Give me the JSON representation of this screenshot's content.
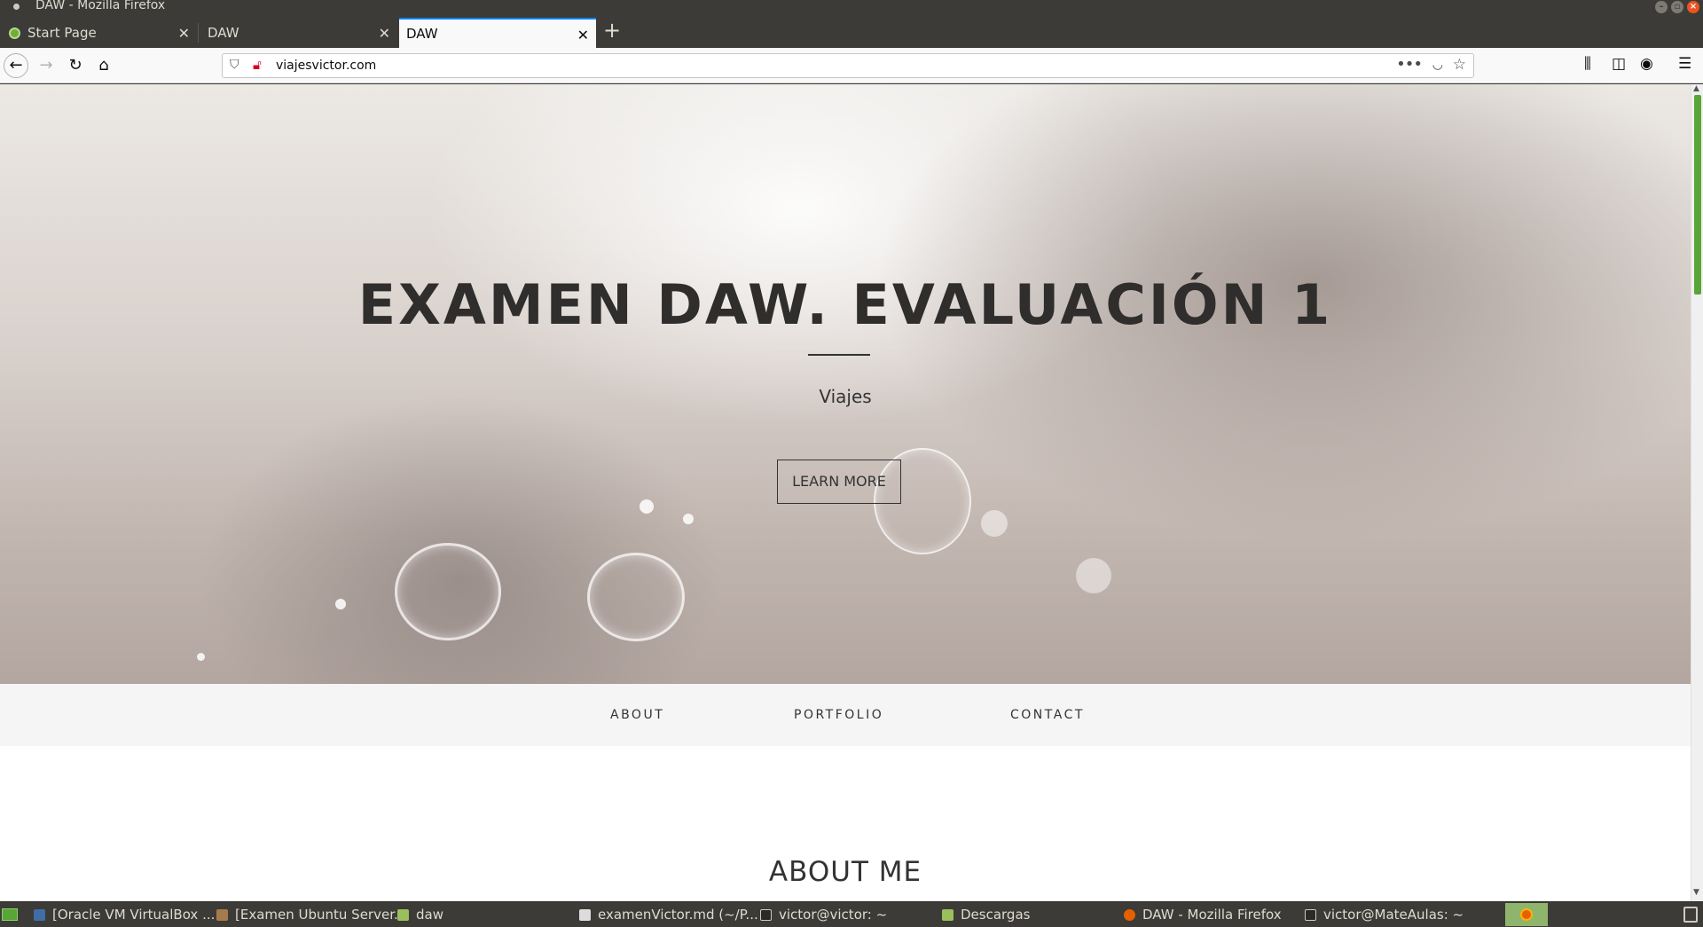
{
  "window": {
    "title": "DAW - Mozilla Firefox"
  },
  "tabs": [
    {
      "label": "Start Page"
    },
    {
      "label": "DAW"
    },
    {
      "label": "DAW"
    }
  ],
  "address_bar": {
    "url": "viajesvictor.com"
  },
  "page": {
    "hero": {
      "title": "EXAMEN DAW. EVALUACIÓN 1",
      "subtitle": "Viajes",
      "button_label": "LEARN MORE"
    },
    "section_nav": [
      "ABOUT",
      "PORTFOLIO",
      "CONTACT"
    ],
    "about_title": "ABOUT ME"
  },
  "taskbar": {
    "items": [
      "[Oracle VM VirtualBox ...",
      "[Examen Ubuntu Server...",
      "daw",
      "examenVictor.md (~/P...",
      "victor@victor: ~",
      "Descargas",
      "DAW - Mozilla Firefox",
      "victor@MateAulas: ~"
    ]
  },
  "colors": {
    "accent_tab": "#0a84ff",
    "scroll_thumb": "#58a637",
    "chrome_dark": "#3c3b37"
  }
}
